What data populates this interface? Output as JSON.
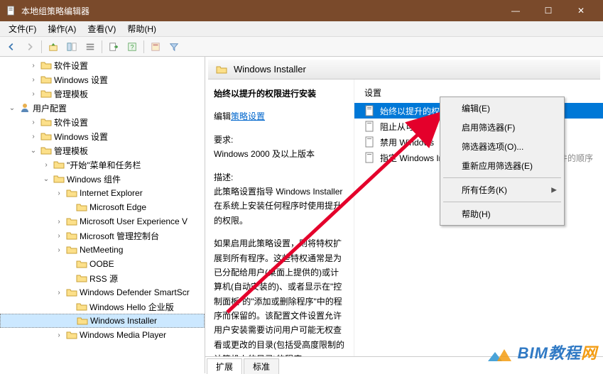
{
  "window": {
    "title": "本地组策略编辑器",
    "btn_min": "—",
    "btn_max": "☐",
    "btn_close": "✕"
  },
  "menubar": {
    "file": "文件(F)",
    "action": "操作(A)",
    "view": "查看(V)",
    "help": "帮助(H)"
  },
  "tree": {
    "n_softset": "软件设置",
    "n_winset": "Windows 设置",
    "n_admintmpl": "管理模板",
    "n_userconf": "用户配置",
    "n_softset2": "软件设置",
    "n_winset2": "Windows 设置",
    "n_admintmpl2": "管理模板",
    "n_startmenu": "\"开始\"菜单和任务栏",
    "n_wincomp": "Windows 组件",
    "n_ie": "Internet Explorer",
    "n_edge": "Microsoft Edge",
    "n_muev": "Microsoft User Experience V",
    "n_mmc": "Microsoft 管理控制台",
    "n_netmeeting": "NetMeeting",
    "n_oobe": "OOBE",
    "n_rss": "RSS 源",
    "n_defender": "Windows Defender SmartScr",
    "n_hello": "Windows Hello 企业版",
    "n_installer": "Windows Installer",
    "n_wmp": "Windows Media Player"
  },
  "right": {
    "header": "Windows Installer",
    "policy_title": "始终以提升的权限进行安装",
    "edit_prefix": "编辑",
    "edit_link": "策略设置",
    "req_label": "要求:",
    "req_value": "Windows 2000 及以上版本",
    "desc_label": "描述:",
    "desc_p1": "此策略设置指导 Windows Installer 在系统上安装任何程序时使用提升的权限。",
    "desc_p2": "如果启用此策略设置，则将特权扩展到所有程序。这些特权通常是为已分配给用户(桌面上提供的)或计算机(自动安装的)、或者显示在\"控制面板\"的\"添加或删除程序\"中的程序而保留的。该配置文件设置允许用户安装需要访问用户可能无权查看或更改的目录(包括受高度限制的计算机上的目录)的程序。"
  },
  "settings": {
    "header": "设置",
    "s1": "始终以提升的权限进行安装",
    "s2": "阻止从可移动",
    "s3": "禁用 Windows",
    "s4": "指定 Windows Installer",
    "s4_tail": "文件的顺序"
  },
  "context_menu": {
    "edit": "编辑(E)",
    "enable_filter": "启用筛选器(F)",
    "filter_options": "筛选器选项(O)...",
    "reapply_filter": "重新应用筛选器(E)",
    "all_tasks": "所有任务(K)",
    "help": "帮助(H)"
  },
  "tabs": {
    "extended": "扩展",
    "standard": "标准"
  },
  "watermark": {
    "text_a": "BIM教程",
    "text_b": "网"
  }
}
